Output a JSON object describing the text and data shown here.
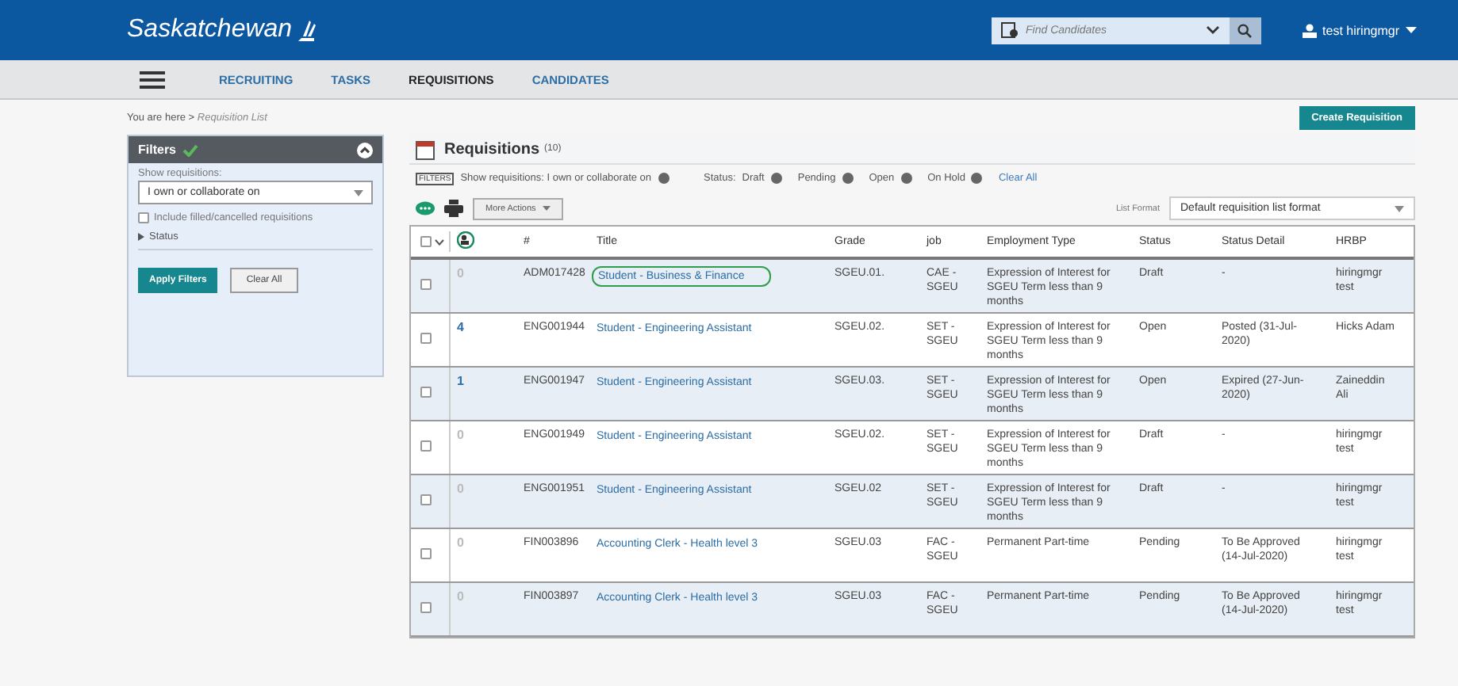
{
  "header": {
    "logo": "Saskatchewan",
    "search": {
      "placeholder": "Find Candidates"
    },
    "user": "test hiringmgr"
  },
  "nav": [
    {
      "label": "RECRUITING",
      "selected": false
    },
    {
      "label": "TASKS",
      "selected": false
    },
    {
      "label": "REQUISITIONS",
      "selected": true
    },
    {
      "label": "CANDIDATES",
      "selected": false
    }
  ],
  "breadcrumb": {
    "prefix": "You are here",
    "separator": ">",
    "current": "Requisition List"
  },
  "filters": {
    "title": "Filters",
    "show_label": "Show requisitions:",
    "show_value": "I own or collaborate on",
    "include_label": "Include filled/cancelled requisitions",
    "include_checked": false,
    "status_label": "Status",
    "status_expanded": false,
    "apply": "Apply Filters",
    "clear": "Clear All"
  },
  "create_button": "Create Requisition",
  "panel": {
    "title": "Requisitions",
    "count": "(10)",
    "filters_tag": "FILTERS",
    "show_filter": "Show requisitions: I own or collaborate on",
    "status_label": "Status:",
    "status_chips": [
      "Draft",
      "Pending",
      "Open",
      "On Hold"
    ],
    "clear_all": "Clear All",
    "more_actions": "More Actions",
    "list_format_label": "List Format",
    "list_format": "Default requisition list format"
  },
  "table": {
    "select_all_checked": false,
    "columns": [
      "#",
      "Title",
      "Grade",
      "job",
      "Employment Type",
      "Status",
      "Status Detail",
      "HRBP"
    ],
    "rows": [
      {
        "checked": false,
        "count": "0",
        "count_active": false,
        "id": "ADM017428",
        "title": "Student - Business & Finance",
        "circled": true,
        "grade": "SGEU.01.",
        "job": "CAE - SGEU",
        "type": "Expression of Interest for SGEU Term less than 9 months",
        "status": "Draft",
        "detail": "-",
        "hrbp": "hiringmgr test"
      },
      {
        "checked": false,
        "count": "4",
        "count_active": true,
        "id": "ENG001944",
        "title": "Student - Engineering Assistant",
        "circled": false,
        "grade": "SGEU.02.",
        "job": "SET - SGEU",
        "type": "Expression of Interest for SGEU Term less than 9 months",
        "status": "Open",
        "detail": "Posted (31-Jul-2020)",
        "hrbp": "Hicks Adam"
      },
      {
        "checked": false,
        "count": "1",
        "count_active": true,
        "id": "ENG001947",
        "title": "Student - Engineering Assistant",
        "circled": false,
        "grade": "SGEU.03.",
        "job": "SET - SGEU",
        "type": "Expression of Interest for SGEU Term less than 9 months",
        "status": "Open",
        "detail": "Expired (27-Jun-2020)",
        "hrbp": "Zaineddin Ali"
      },
      {
        "checked": false,
        "count": "0",
        "count_active": false,
        "id": "ENG001949",
        "title": "Student - Engineering Assistant",
        "circled": false,
        "grade": "SGEU.02.",
        "job": "SET - SGEU",
        "type": "Expression of Interest for SGEU Term less than 9 months",
        "status": "Draft",
        "detail": "-",
        "hrbp": "hiringmgr test"
      },
      {
        "checked": false,
        "count": "0",
        "count_active": false,
        "id": "ENG001951",
        "title": "Student - Engineering Assistant",
        "circled": false,
        "grade": "SGEU.02",
        "job": "SET - SGEU",
        "type": "Expression of Interest for SGEU Term less than 9 months",
        "status": "Draft",
        "detail": "-",
        "hrbp": "hiringmgr test"
      },
      {
        "checked": false,
        "count": "0",
        "count_active": false,
        "id": "FIN003896",
        "title": "Accounting Clerk - Health level 3",
        "circled": false,
        "grade": "SGEU.03",
        "job": "FAC - SGEU",
        "type": "Permanent Part-time",
        "status": "Pending",
        "detail": "To Be Approved (14-Jul-2020)",
        "hrbp": "hiringmgr test"
      },
      {
        "checked": false,
        "count": "0",
        "count_active": false,
        "id": "FIN003897",
        "title": "Accounting Clerk - Health level 3",
        "circled": false,
        "grade": "SGEU.03",
        "job": "FAC - SGEU",
        "type": "Permanent Part-time",
        "status": "Pending",
        "detail": "To Be Approved (14-Jul-2020)",
        "hrbp": "hiringmgr test"
      }
    ]
  }
}
